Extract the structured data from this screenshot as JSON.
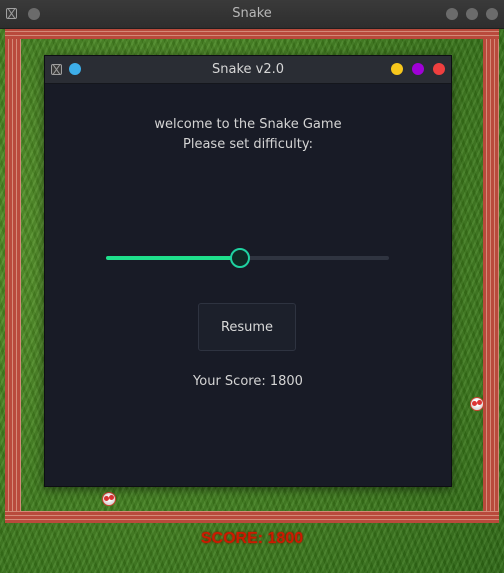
{
  "outer_window": {
    "title": "Snake",
    "buttons": [
      "menu-dot",
      "minimize",
      "maximize",
      "close"
    ]
  },
  "game": {
    "score_label": "SCORE: 1800",
    "colors": {
      "grass": "#4a8a25",
      "brick": "#b94a3c",
      "score": "#cc1a00"
    }
  },
  "dialog": {
    "title": "Snake v2.0",
    "welcome": "welcome to the Snake Game",
    "prompt": "Please set difficulty:",
    "difficulty_fraction": 0.47,
    "resume_label": "Resume",
    "score_text": "Your Score: 1800",
    "colors": {
      "pin": "#3daee9",
      "minimize": "#f7c71c",
      "maximize": "#a000d8",
      "close": "#ef3f3f",
      "slider_fill": "#1fe08c"
    }
  }
}
